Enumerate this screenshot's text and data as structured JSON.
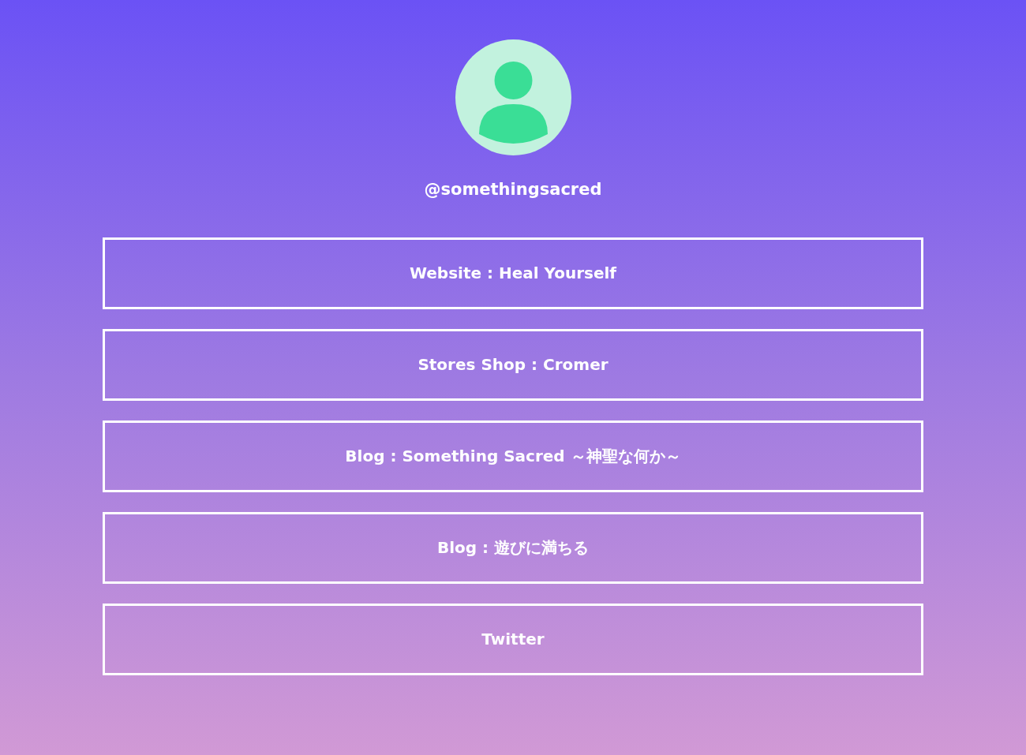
{
  "profile": {
    "username": "@somethingsacred"
  },
  "links": [
    {
      "label": "Website : Heal Yourself"
    },
    {
      "label": "Stores Shop : Cromer"
    },
    {
      "label": "Blog : Something Sacred ～神聖な何か～"
    },
    {
      "label": "Blog : 遊びに満ちる"
    },
    {
      "label": "Twitter"
    }
  ]
}
